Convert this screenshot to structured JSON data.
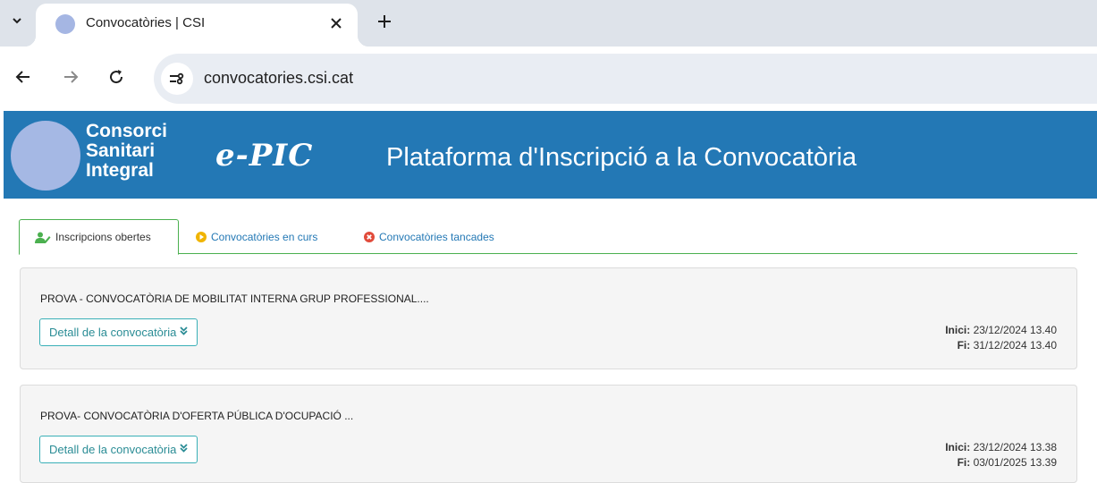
{
  "browser": {
    "tab_title": "Convocatòries | CSI",
    "url": "convocatories.csi.cat"
  },
  "header": {
    "logo_lines": [
      "Consorci",
      "Sanitari",
      "Integral"
    ],
    "brand": "e-PIC",
    "title": "Plataforma d'Inscripció a la Convocatòria",
    "color": "#2378b5"
  },
  "tabs": [
    {
      "label": "Inscripcions obertes",
      "icon": "user-edit-icon",
      "active": true
    },
    {
      "label": "Convocatòries en curs",
      "icon": "play-circle-icon",
      "color": "#f0b400"
    },
    {
      "label": "Convocatòries tancades",
      "icon": "times-circle-icon",
      "color": "#e14b3b"
    }
  ],
  "convocatories": [
    {
      "title": "PROVA - CONVOCATÒRIA DE MOBILITAT INTERNA GRUP PROFESSIONAL....",
      "detail_label": "Detall de la convocatòria",
      "inici_label": "Inici:",
      "inici": "23/12/2024 13.40",
      "fi_label": "Fi:",
      "fi": "31/12/2024 13.40"
    },
    {
      "title": "PROVA- CONVOCATÒRIA D'OFERTA PÚBLICA D'OCUPACIÓ ...",
      "detail_label": "Detall de la convocatòria",
      "inici_label": "Inici:",
      "inici": "23/12/2024 13.38",
      "fi_label": "Fi:",
      "fi": "03/01/2025 13.39"
    }
  ]
}
